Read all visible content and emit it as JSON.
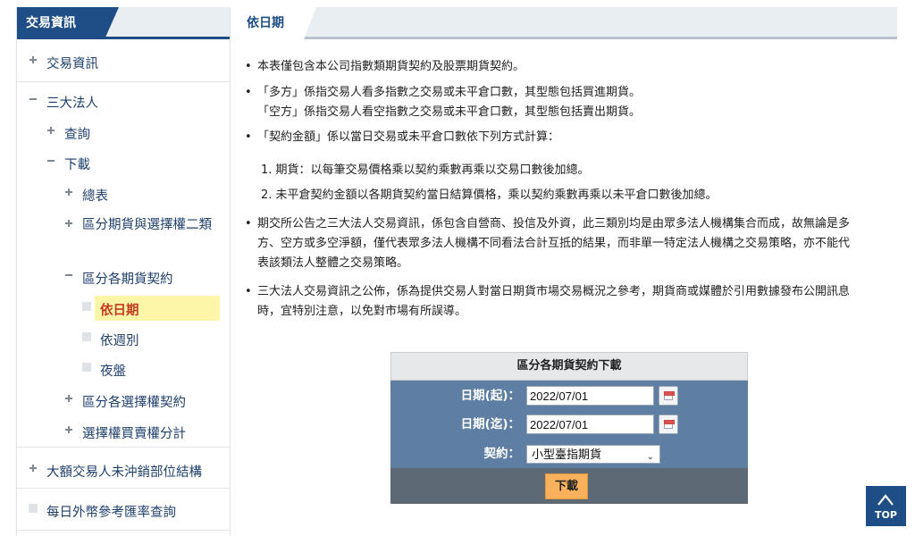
{
  "sidebar": {
    "header": "交易資訊",
    "items": [
      {
        "label": "交易資訊",
        "marker": "plus"
      },
      {
        "label": "三大法人",
        "marker": "minus"
      },
      {
        "label": "查詢",
        "marker": "plus"
      },
      {
        "label": "下載",
        "marker": "minus"
      },
      {
        "label": "總表",
        "marker": "plus"
      },
      {
        "label": "區分期貨與選擇權二類",
        "marker": "plus"
      },
      {
        "label": "區分各期貨契約",
        "marker": "minus"
      },
      {
        "label": "依日期",
        "marker": "blank",
        "active": true
      },
      {
        "label": "依週別",
        "marker": "blank"
      },
      {
        "label": "夜盤",
        "marker": "blank"
      },
      {
        "label": "區分各選擇權契約",
        "marker": "plus"
      },
      {
        "label": "選擇權買賣權分計",
        "marker": "plus"
      },
      {
        "label": "大額交易人未沖銷部位結構",
        "marker": "plus"
      },
      {
        "label": "每日外幣參考匯率查詢",
        "marker": "blank"
      }
    ]
  },
  "main": {
    "tab_title": "依日期",
    "notes": [
      "本表僅包含本公司指數類期貨契約及股票期貨契約。",
      "「多方」係指交易人看多指數之交易或未平倉口數，其型態包括買進期貨。",
      "「空方」係指交易人看空指數之交易或未平倉口數，其型態包括賣出期貨。",
      "「契約金額」係以當日交易或未平倉口數依下列方式計算：",
      "1. 期貨：以每筆交易價格乘以契約乘數再乘以交易口數後加總。",
      "2. 未平倉契約金額以各期貨契約當日結算價格，乘以契約乘數再乘以未平倉口數後加總。",
      "期交所公告之三大法人交易資訊，係包含自營商、投信及外資，此三類別均是由眾多法人機構集合而成，故無論是多",
      "方、空方或多空淨額，僅代表眾多法人機構不同看法合計互抵的結果，而非單一特定法人機構之交易策略，亦不能代",
      "表該類法人整體之交易策略。",
      "三大法人交易資訊之公佈，係為提供交易人對當日期貨市場交易概況之參考，期貨商或媒體於引用數據發布公開訊息",
      "時，宜特別注意，以免對市場有所誤導。"
    ]
  },
  "download_panel": {
    "title": "區分各期貨契約下載",
    "start_label": "日期(起)：",
    "start_value": "2022/07/01",
    "end_label": "日期(迄)：",
    "end_value": "2022/07/01",
    "contract_label": "契約：",
    "contract_value": "小型臺指期貨",
    "button_label": "下載"
  },
  "top_button": {
    "label": "TOP"
  },
  "colors": {
    "accent": "#1f4e86",
    "active_bg": "#fdf6a9",
    "active_text": "#c33b1e",
    "button": "#f9b25b",
    "panel_body": "#5e7fa3"
  }
}
